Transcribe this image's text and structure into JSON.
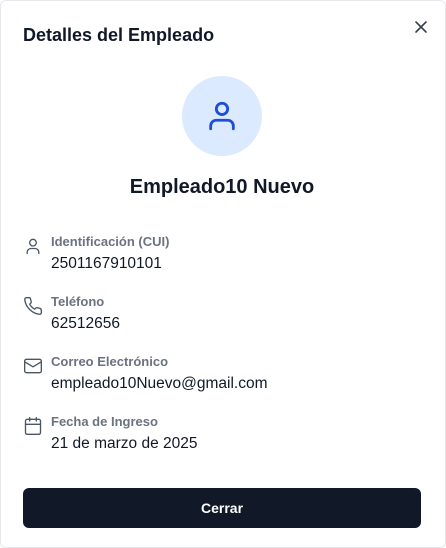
{
  "dialog": {
    "title": "Detalles del Empleado",
    "close_icon": "close-icon"
  },
  "employee": {
    "avatar_icon": "user-icon",
    "name": "Empleado10 Nuevo"
  },
  "fields": [
    {
      "icon": "user-icon",
      "label": "Identificación (CUI)",
      "value": "2501167910101"
    },
    {
      "icon": "phone-icon",
      "label": "Teléfono",
      "value": "62512656"
    },
    {
      "icon": "mail-icon",
      "label": "Correo Electrónico",
      "value": "empleado10Nuevo@gmail.com"
    },
    {
      "icon": "calendar-icon",
      "label": "Fecha de Ingreso",
      "value": "21 de marzo de 2025"
    }
  ],
  "actions": {
    "close_label": "Cerrar"
  },
  "colors": {
    "avatar_bg": "#dbeafe",
    "avatar_icon": "#1d4ed8",
    "primary_button": "#111827",
    "label_gray": "#6b7280"
  }
}
